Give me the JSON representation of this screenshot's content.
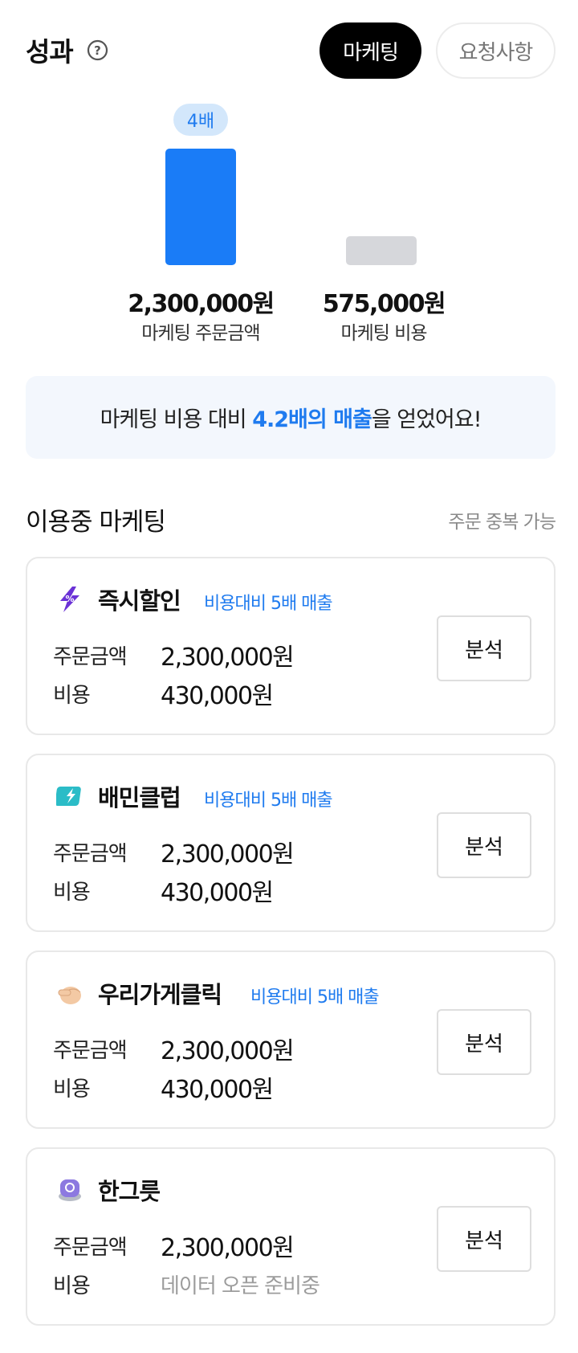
{
  "header": {
    "title": "성과",
    "help_icon": "question-circle-icon",
    "tabs": [
      {
        "label": "마케팅",
        "active": true
      },
      {
        "label": "요청사항",
        "active": false
      }
    ]
  },
  "performance": {
    "ratio_badge": "4배",
    "bars": [
      {
        "value": "2,300,000원",
        "label": "마케팅 주문금액",
        "amount": 2300000,
        "color": "#1a7cf7"
      },
      {
        "value": "575,000원",
        "label": "마케팅 비용",
        "amount": 575000,
        "color": "#d6d7db"
      }
    ],
    "summary": {
      "prefix": "마케팅 비용 대비 ",
      "highlight": "4.2배의 매출",
      "suffix": "을 얻었어요!"
    }
  },
  "section": {
    "title": "이용중 마케팅",
    "note": "주문 중복 가능"
  },
  "cards": [
    {
      "icon": "lightning-discount-icon",
      "name": "즉시할인",
      "roi": "비용대비 5배 매출",
      "order_label": "주문금액",
      "order_value": "2,300,000원",
      "cost_label": "비용",
      "cost_value": "430,000원",
      "button": "분석"
    },
    {
      "icon": "baemin-club-ticket-icon",
      "name": "배민클럽",
      "roi": "비용대비 5배 매출",
      "order_label": "주문금액",
      "order_value": "2,300,000원",
      "cost_label": "비용",
      "cost_value": "430,000원",
      "button": "분석"
    },
    {
      "icon": "hand-click-icon",
      "name": "우리가게클릭",
      "roi": "비용대비 5배 매출",
      "order_label": "주문금액",
      "order_value": "2,300,000원",
      "cost_label": "비용",
      "cost_value": "430,000원",
      "button": "분석"
    },
    {
      "icon": "han-badge-icon",
      "name": "한그릇",
      "roi": "",
      "order_label": "주문금액",
      "order_value": "2,300,000원",
      "cost_label": "비용",
      "cost_value": "데이터 오픈 준비중",
      "button": "분석"
    }
  ]
}
